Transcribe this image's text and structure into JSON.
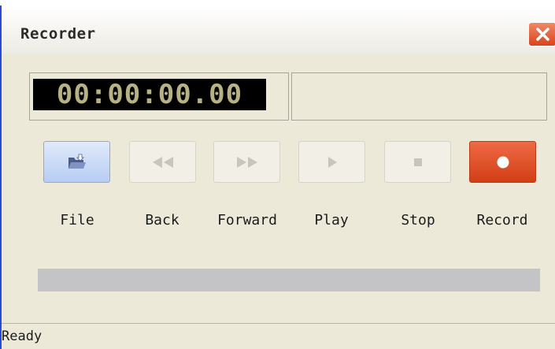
{
  "window": {
    "title": "Recorder",
    "close_icon": "close-icon"
  },
  "display": {
    "time": "00:00:00.00",
    "info": ""
  },
  "controls": [
    {
      "name": "file",
      "label": "File",
      "icon": "folder-open-icon",
      "enabled": true
    },
    {
      "name": "back",
      "label": "Back",
      "icon": "rewind-icon",
      "enabled": false
    },
    {
      "name": "forward",
      "label": "Forward",
      "icon": "fast-forward-icon",
      "enabled": false
    },
    {
      "name": "play",
      "label": "Play",
      "icon": "play-icon",
      "enabled": false
    },
    {
      "name": "stop",
      "label": "Stop",
      "icon": "stop-icon",
      "enabled": false
    },
    {
      "name": "record",
      "label": "Record",
      "icon": "record-icon",
      "enabled": true
    }
  ],
  "progress": {
    "fraction": 0
  },
  "status": {
    "text": "Ready"
  },
  "colors": {
    "title_border": "#2a4bd6",
    "record_button": "#d23f16",
    "lcd_digits": "#b7b283",
    "progress_track": "#c4c3c6"
  }
}
